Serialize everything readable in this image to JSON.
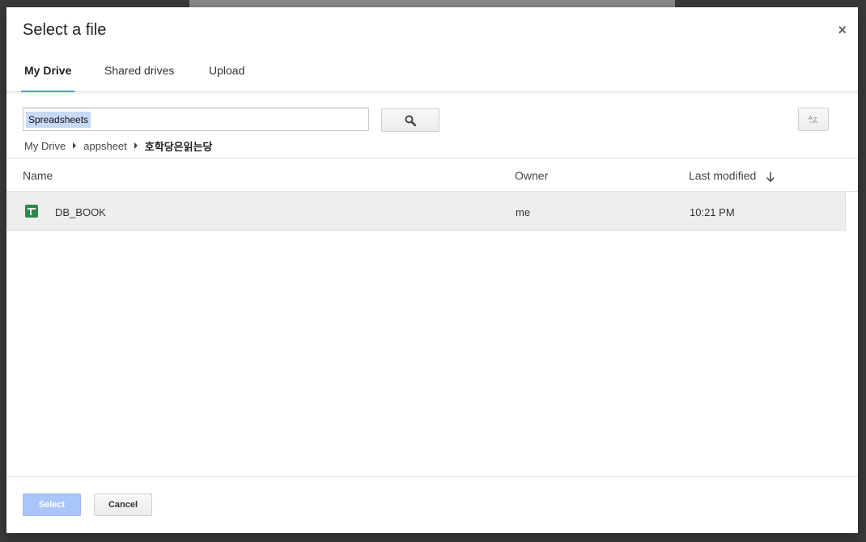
{
  "dialog": {
    "title": "Select a file",
    "close_label": "×"
  },
  "tabs": [
    {
      "label": "My Drive",
      "active": true
    },
    {
      "label": "Shared drives",
      "active": false
    },
    {
      "label": "Upload",
      "active": false
    }
  ],
  "search": {
    "value": "Spreadsheets",
    "button_icon": "search-icon"
  },
  "sort": {
    "icon": "sort-az-icon",
    "label": "AZ"
  },
  "breadcrumb": [
    "My Drive",
    "appsheet",
    "호학당은읽는당"
  ],
  "table": {
    "columns": {
      "name": "Name",
      "owner": "Owner",
      "last_modified": "Last modified"
    },
    "sort_direction_icon": "arrow-down-icon",
    "rows": [
      {
        "icon": "google-sheets-icon",
        "name": "DB_BOOK",
        "owner": "me",
        "last_modified": "10:21 PM",
        "selected": true
      }
    ]
  },
  "footer": {
    "select_label": "Select",
    "cancel_label": "Cancel"
  },
  "colors": {
    "accent": "#4d90fe",
    "select_button_disabled": "#a9c5fb",
    "sheets_green": "#2f8a4a",
    "selected_row": "#eeeeee"
  }
}
